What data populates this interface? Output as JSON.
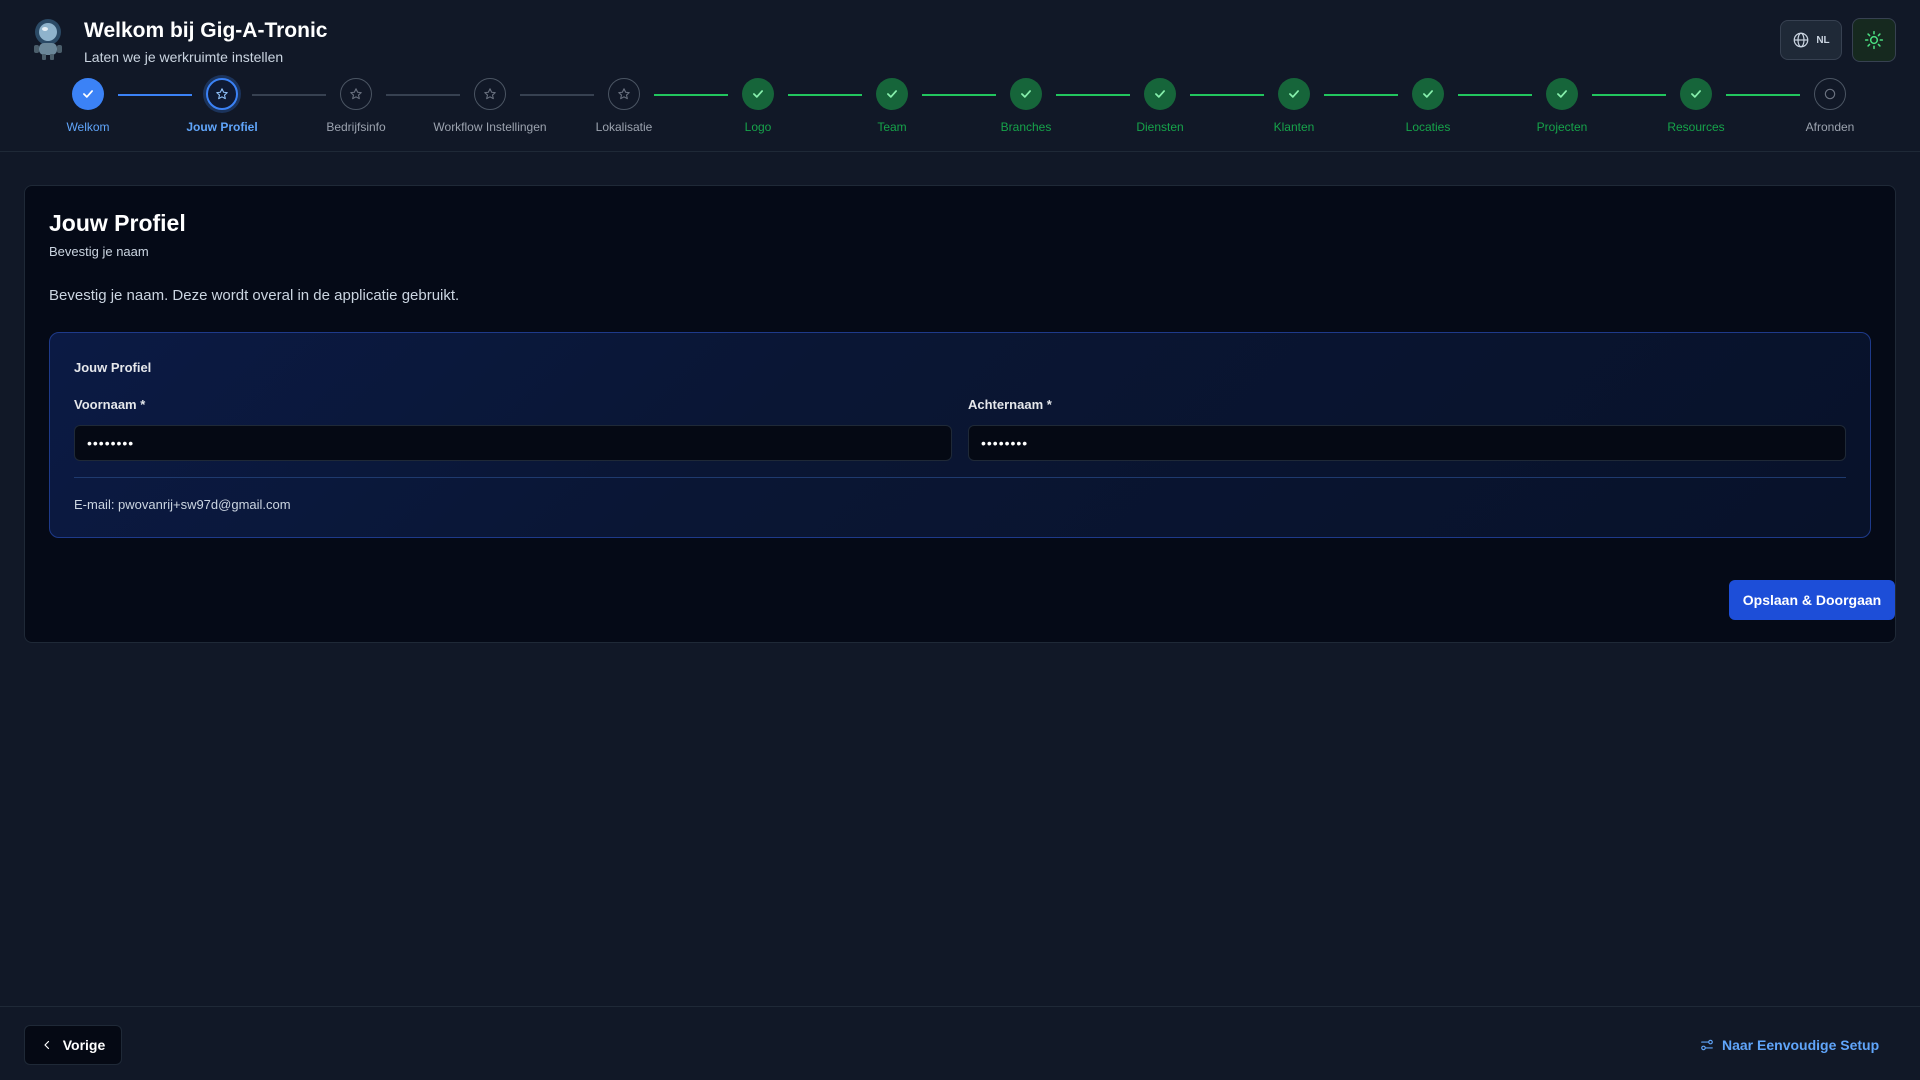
{
  "header": {
    "title": "Welkom bij Gig-A-Tronic",
    "subtitle": "Laten we je werkruimte instellen",
    "language": "NL"
  },
  "steps": [
    {
      "label": "Welkom",
      "state": "active"
    },
    {
      "label": "Jouw Profiel",
      "state": "current"
    },
    {
      "label": "Bedrijfsinfo",
      "state": "pending"
    },
    {
      "label": "Workflow Instellingen",
      "state": "pending"
    },
    {
      "label": "Lokalisatie",
      "state": "pending"
    },
    {
      "label": "Logo",
      "state": "done"
    },
    {
      "label": "Team",
      "state": "done"
    },
    {
      "label": "Branches",
      "state": "done"
    },
    {
      "label": "Diensten",
      "state": "done"
    },
    {
      "label": "Klanten",
      "state": "done"
    },
    {
      "label": "Locaties",
      "state": "done"
    },
    {
      "label": "Projecten",
      "state": "done"
    },
    {
      "label": "Resources",
      "state": "done"
    },
    {
      "label": "Afronden",
      "state": "final"
    }
  ],
  "card": {
    "title": "Jouw Profiel",
    "subtitle": "Bevestig je naam",
    "description": "Bevestig je naam. Deze wordt overal in de applicatie gebruikt.",
    "section_title": "Jouw Profiel",
    "first_name_label": "Voornaam *",
    "first_name_value": "••••••••",
    "last_name_label": "Achternaam *",
    "last_name_value": "••••••••",
    "email_text": "E-mail: pwovanrij+sw97d@gmail.com",
    "save_label": "Opslaan & Doorgaan"
  },
  "footer": {
    "previous_label": "Vorige",
    "simple_setup_label": "Naar Eenvoudige Setup"
  },
  "colors": {
    "accent": "#3b82f6",
    "success": "#22c55e",
    "background": "#111827"
  }
}
